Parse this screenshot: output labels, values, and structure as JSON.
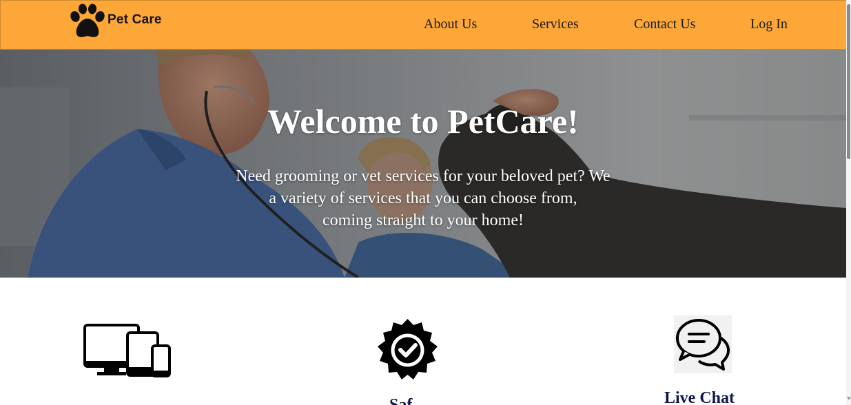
{
  "brand": {
    "name": "Pet Care",
    "logo_icon": "paw-icon"
  },
  "nav": {
    "items": [
      {
        "label": "About Us"
      },
      {
        "label": "Services"
      },
      {
        "label": "Contact Us"
      },
      {
        "label": "Log In"
      }
    ]
  },
  "hero": {
    "title": "Welcome to PetCare!",
    "text_line1": "Need grooming or vet services for your beloved pet? We",
    "text_line2": "a variety of services that you can choose from,",
    "text_line3": "coming straight to your home!"
  },
  "features": [
    {
      "icon": "devices-icon",
      "label": ""
    },
    {
      "icon": "verified-badge-icon",
      "label": "Saf"
    },
    {
      "icon": "chat-bubbles-icon",
      "label": "Live Chat"
    }
  ],
  "colors": {
    "navbar": "#fca738",
    "feature_label": "#10174a",
    "hero_text": "#ffffff"
  }
}
